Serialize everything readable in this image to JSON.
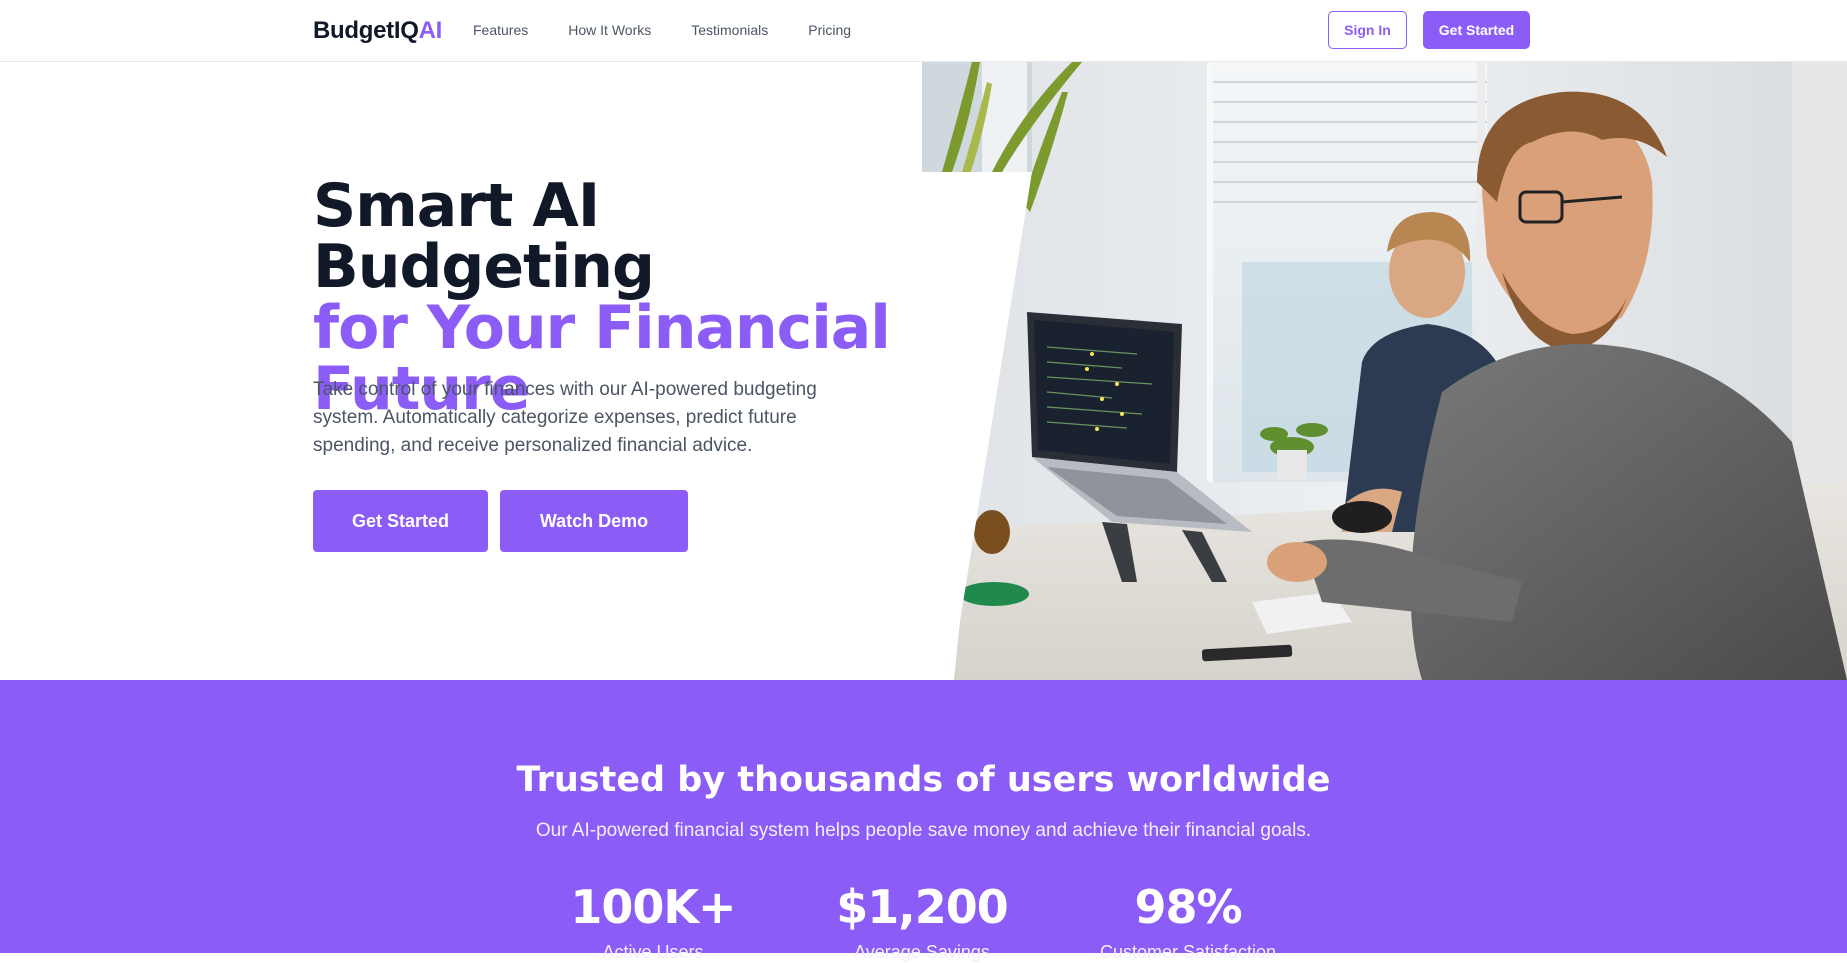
{
  "nav": {
    "logo_main": "BudgetIQ",
    "logo_accent": "AI",
    "links": [
      "Features",
      "How It Works",
      "Testimonials",
      "Pricing"
    ],
    "sign_in": "Sign In",
    "get_started": "Get Started"
  },
  "hero": {
    "title_line1": "Smart AI Budgeting",
    "title_line2": "for Your Financial",
    "title_line3": "Future",
    "description": "Take control of your finances with our AI-powered budgeting system. Automatically categorize expenses, predict future spending, and receive personalized financial advice.",
    "primary_button": "Get Started",
    "secondary_button": "Watch Demo"
  },
  "stats": {
    "title": "Trusted by thousands of users worldwide",
    "subtitle": "Our AI-powered financial system helps people save money and achieve their financial goals.",
    "items": [
      {
        "value": "100K+",
        "label": "Active Users"
      },
      {
        "value": "$1,200",
        "label": "Average Savings"
      },
      {
        "value": "98%",
        "label": "Customer Satisfaction"
      }
    ]
  },
  "colors": {
    "accent": "#8b5cf6",
    "heading": "#111827",
    "body_text": "#4b5563"
  }
}
